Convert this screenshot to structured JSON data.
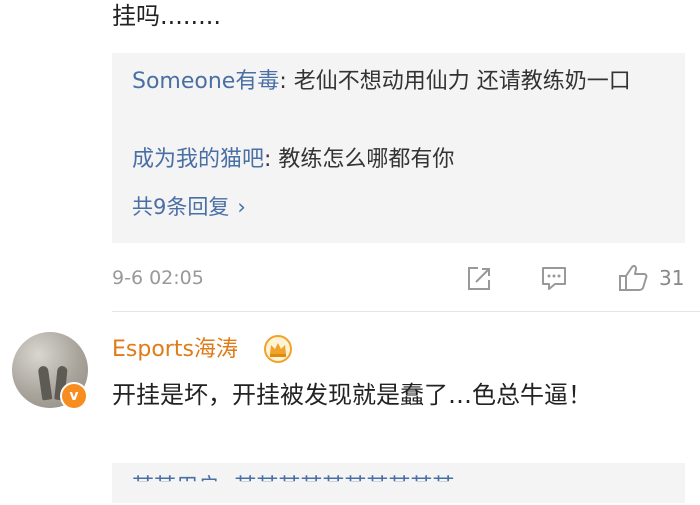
{
  "previous_comment": {
    "text_tail": "挂吗........"
  },
  "replies_box": {
    "replies": [
      {
        "user": "Someone有毒",
        "separator": ": ",
        "text": "老仙不想动用仙力 还请教练奶一口"
      },
      {
        "user": "成为我的猫吧",
        "separator": ": ",
        "text": "教练怎么哪都有你"
      }
    ],
    "more_replies_label": "共9条回复",
    "more_chevron": "›"
  },
  "meta": {
    "timestamp": "9-6 02:05",
    "like_count": "31",
    "icons": [
      "share-icon",
      "comment-icon",
      "like-icon"
    ]
  },
  "comment": {
    "username": "Esports海涛",
    "badge_icon": "crown-icon",
    "verified_badge": "v",
    "text": "开挂是坏，开挂被发现就是蠢了…色总牛逼！"
  },
  "next_reply_box": {
    "partial_text": "某某用户: 某某某某某某某某某某"
  },
  "colors": {
    "link_blue": "#4a6fa5",
    "username_orange": "#e07b1a",
    "reply_bg": "#f4f4f4",
    "verified_orange": "#f78c1f"
  }
}
